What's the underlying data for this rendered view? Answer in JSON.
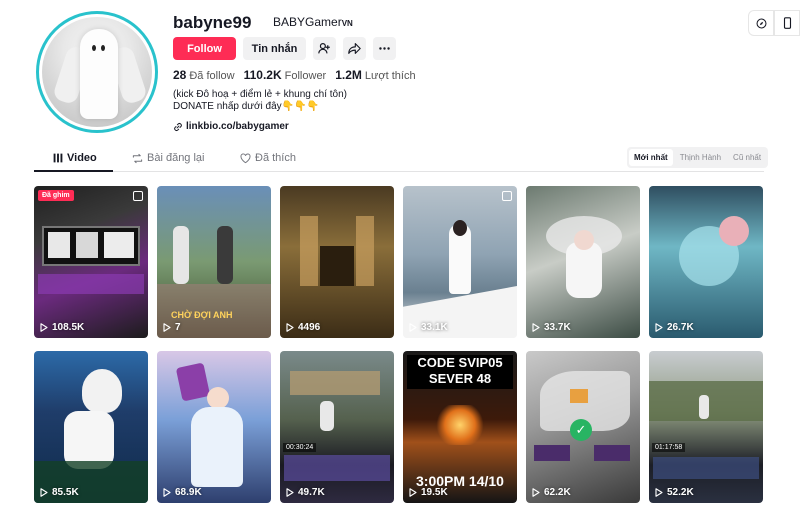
{
  "profile": {
    "username": "babyne99",
    "nickname": "BABYGamer",
    "nickname_suffix": "VN",
    "follow_label": "Follow",
    "message_label": "Tin nhắn",
    "stats": {
      "following_count": "28",
      "following_label": "Đã follow",
      "followers_count": "110.2K",
      "followers_label": "Follower",
      "likes_count": "1.2M",
      "likes_label": "Lượt thích"
    },
    "bio_line1": "(kick Đô hoạ + điểm lẻ + khung chí tôn)",
    "bio_line2": "DONATE nhấp dưới đây👇👇👇",
    "link": "linkbio.co/babygamer"
  },
  "tabs": [
    {
      "label": "Video",
      "icon": "grid-icon"
    },
    {
      "label": "Bài đăng lại",
      "icon": "repost-icon"
    },
    {
      "label": "Đã thích",
      "icon": "heart-outline-icon"
    }
  ],
  "sort": {
    "options": [
      "Mới nhất",
      "Thịnh Hành",
      "Cũ nhất"
    ],
    "selected": "Mới nhất"
  },
  "videos": [
    {
      "views": "108.5K",
      "pinned_label": "Đã ghim",
      "photo": true
    },
    {
      "views": "7",
      "overlay_text": "CHỜ ĐỢI ANH"
    },
    {
      "views": "4496"
    },
    {
      "views": "33.1K",
      "photo": true
    },
    {
      "views": "33.7K"
    },
    {
      "views": "26.7K"
    },
    {
      "views": "85.5K"
    },
    {
      "views": "68.9K"
    },
    {
      "views": "49.7K",
      "hud": "00:30:24"
    },
    {
      "views": "19.5K",
      "code_line1": "CODE SVIP05",
      "code_line2": "SEVER 48",
      "date_text": "3:00PM 14/10"
    },
    {
      "views": "62.2K"
    },
    {
      "views": "52.2K",
      "hud": "01:17:58"
    }
  ],
  "colors": {
    "accent": "#fe2c55",
    "avatar_ring": "#29c2cc"
  }
}
